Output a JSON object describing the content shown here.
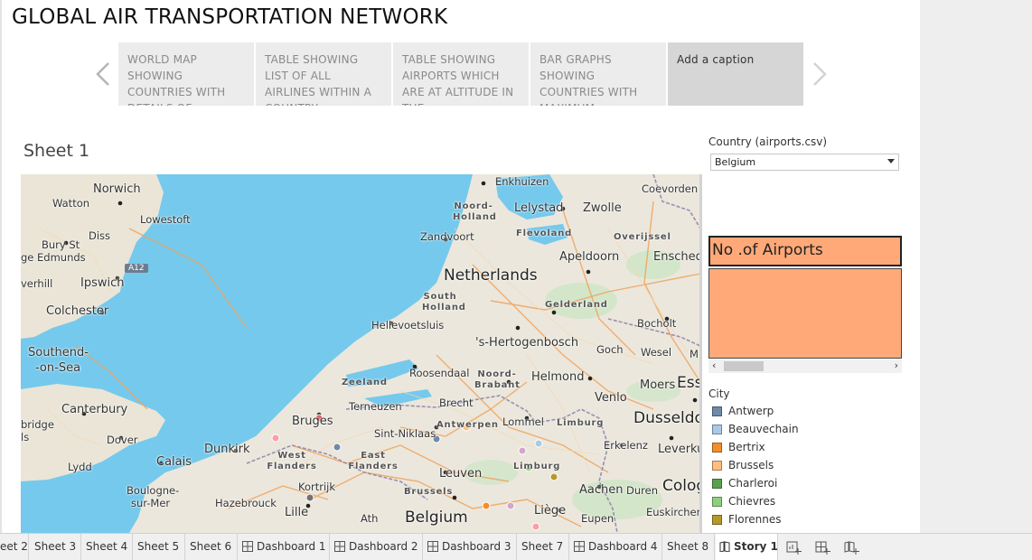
{
  "story": {
    "title": "GLOBAL AIR TRANSPORTATION NETWORK",
    "captions": [
      {
        "text": "WORLD MAP SHOWING COUNTRIES WITH DETAILS OF"
      },
      {
        "text": "TABLE SHOWING LIST OF ALL AIRLINES WITHIN A COUNTRY."
      },
      {
        "text": "TABLE SHOWING AIRPORTS WHICH ARE AT ALTITUDE IN THE"
      },
      {
        "text": "BAR GRAPHS SHOWING COUNTRIES WITH MAXIMUM"
      },
      {
        "text": "Add a caption"
      }
    ]
  },
  "sheet": {
    "title": "Sheet 1"
  },
  "map": {
    "labels": {
      "norwich": "Norwich",
      "watton": "Watton",
      "lowestoft": "Lowestoft",
      "diss": "Diss",
      "bury": "Bury St",
      "edmunds": "ge Edmunds",
      "a12": "A12",
      "haverhill": "verhill",
      "ipswich": "Ipswich",
      "colchester": "Colchester",
      "southend": "Southend-",
      "onsea": "-on-Sea",
      "canterbury": "Canterbury",
      "cambridge": "bridge",
      "ls": "ls",
      "dover": "Dover",
      "lydd": "Lydd",
      "calais": "Calais",
      "boulogne1": "Boulogne-",
      "boulogne2": "sur-Mer",
      "hazebrouck": "Hazebrouck",
      "lille": "Lille",
      "dunkirk": "Dunkirk",
      "westflanders": "West Flanders",
      "bruges": "Bruges",
      "kortrijk": "Kortrijk",
      "ath": "Ath",
      "belgium": "Belgium",
      "eastflanders": "East Flanders",
      "sintniklaas": "Sint-Niklaas",
      "brussels": "Brussels",
      "leuven": "Leuven",
      "antwerpen": "Antwerpen",
      "lommel": "Lommel",
      "limburg1": "Limburg",
      "limburg2": "Limburg",
      "liege": "Liège",
      "eupen": "Eupen",
      "aachen": "Aachen",
      "duren": "Duren",
      "cologne": "Colog",
      "euskirchen": "Euskirchen",
      "leverkusen": "Leverku",
      "erkelenz": "Erkelenz",
      "dusseldorf": "Dusseldor",
      "venlo": "Venlo",
      "moers": "Moers",
      "essen": "Esse",
      "brecht": "Brecht",
      "terneuzen": "Terneuzen",
      "zeeland": "Zeeland",
      "roosendaal": "Roosendaal",
      "noordbrabant": "Noord-\nBrabant",
      "helmond": "Helmond",
      "goch": "Goch",
      "wesel": "Wesel",
      "hertogenbosch": "'s-Hertogenbosch",
      "bocholt": "Bocholt",
      "hellevoetsluis": "Hellevoetsluis",
      "southholland": "South\nHolland",
      "gelderland": "Gelderland",
      "netherlands": "Netherlands",
      "apeldoorn": "Apeldoorn",
      "enschede": "Ensched",
      "zandvoort": "Zandvoort",
      "noordholland": "Noord-\nHolland",
      "flevoland": "Flevoland",
      "overijssel": "Overijssel",
      "lelystad": "Lelystad",
      "zwolle": "Zwolle",
      "enkhuizen": "Enkhuizen",
      "coevorden": "Coevorden",
      "m": "M"
    }
  },
  "filter": {
    "title": "Country (airports.csv)",
    "value": "Belgium"
  },
  "kpi": {
    "title": "No .of Airports"
  },
  "legend": {
    "title": "City",
    "items": [
      {
        "label": "Antwerp",
        "color": "#6e8aa8"
      },
      {
        "label": "Beauvechain",
        "color": "#a9c9e6"
      },
      {
        "label": "Bertrix",
        "color": "#f28e2b"
      },
      {
        "label": "Brussels",
        "color": "#ffbe7d"
      },
      {
        "label": "Charleroi",
        "color": "#59a14f"
      },
      {
        "label": "Chievres",
        "color": "#8cd17d"
      },
      {
        "label": "Florennes",
        "color": "#b6992d"
      }
    ]
  },
  "tabs": [
    {
      "label": "eet 2",
      "type": "sheet"
    },
    {
      "label": "Sheet 3",
      "type": "sheet"
    },
    {
      "label": "Sheet 4",
      "type": "sheet"
    },
    {
      "label": "Sheet 5",
      "type": "sheet"
    },
    {
      "label": "Sheet 6",
      "type": "sheet"
    },
    {
      "label": "Dashboard 1",
      "type": "dashboard"
    },
    {
      "label": "Dashboard 2",
      "type": "dashboard"
    },
    {
      "label": "Dashboard 3",
      "type": "dashboard"
    },
    {
      "label": "Sheet 7",
      "type": "sheet"
    },
    {
      "label": "Dashboard 4",
      "type": "dashboard"
    },
    {
      "label": "Sheet 8",
      "type": "sheet"
    },
    {
      "label": "Story 1",
      "type": "story"
    }
  ],
  "tab_actions": [
    "new-worksheet-icon",
    "new-dashboard-icon",
    "new-story-icon"
  ]
}
